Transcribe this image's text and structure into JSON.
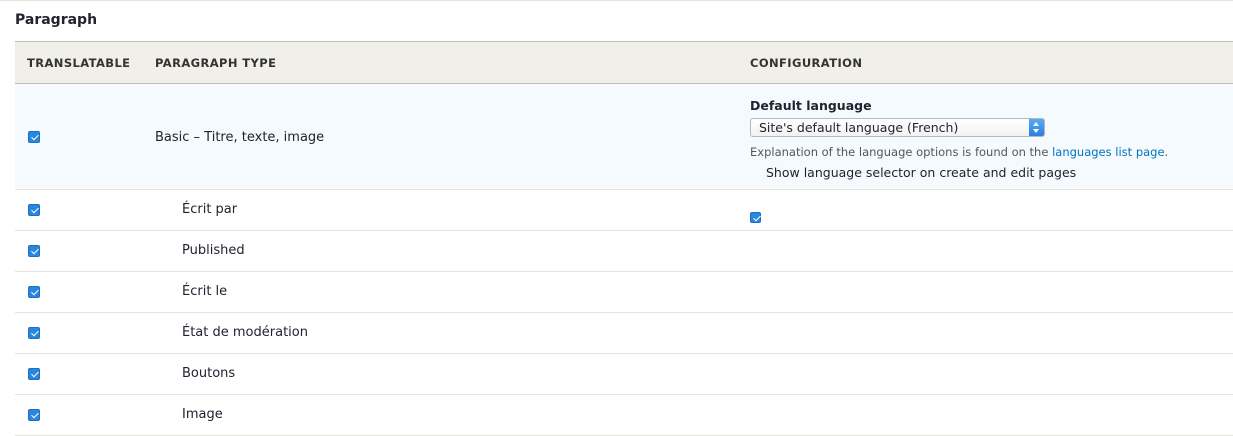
{
  "section": {
    "title": "Paragraph"
  },
  "table": {
    "headers": {
      "translatable": "TRANSLATABLE",
      "paragraph_type": "PARAGRAPH TYPE",
      "configuration": "CONFIGURATION"
    },
    "main_row": {
      "checked": true,
      "label": "Basic – Titre, texte, image",
      "config": {
        "default_language_label": "Default language",
        "default_language_value": "Site's default language (French)",
        "explanation_prefix": "Explanation of the language options is found on the ",
        "explanation_link": "languages list page",
        "explanation_suffix": ".",
        "show_selector_checked": true,
        "show_selector_label": "Show language selector on create and edit pages"
      }
    },
    "field_rows": [
      {
        "label": "Écrit par",
        "checked": true
      },
      {
        "label": "Published",
        "checked": true
      },
      {
        "label": "Écrit le",
        "checked": true
      },
      {
        "label": "État de modération",
        "checked": true
      },
      {
        "label": "Boutons",
        "checked": true
      },
      {
        "label": "Image",
        "checked": true
      }
    ]
  },
  "colors": {
    "accent": "#2a86de",
    "link": "#0074bd",
    "header_bg": "#f0efea",
    "highlight_row_bg": "#f5fafe"
  }
}
